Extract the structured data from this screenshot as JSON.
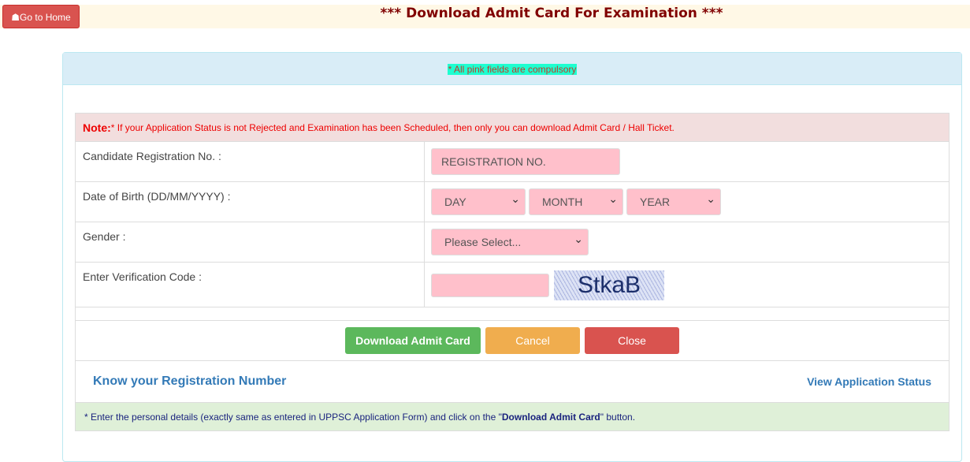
{
  "header": {
    "home_label": "Go to Home",
    "title": "*** Download Admit Card For Examination ***"
  },
  "panel": {
    "notice": "* All pink fields are compulsory"
  },
  "note": {
    "label": "Note:",
    "text": " * If your Application Status is not Rejected and Examination has been Scheduled, then only you can download Admit Card / Hall Ticket."
  },
  "form": {
    "registration": {
      "label": "Candidate Registration No. :",
      "placeholder": "REGISTRATION NO."
    },
    "dob": {
      "label": "Date of Birth (DD/MM/YYYY) :",
      "day": "DAY",
      "month": "MONTH",
      "year": "YEAR"
    },
    "gender": {
      "label": "Gender :",
      "selected": "Please Select..."
    },
    "verification": {
      "label": "Enter Verification Code :",
      "value": "",
      "captcha": "StkaB"
    }
  },
  "buttons": {
    "download": "Download Admit Card",
    "cancel": "Cancel",
    "close": "Close"
  },
  "links": {
    "know_reg": "Know your Registration Number",
    "view_status": "View Application Status"
  },
  "footer": {
    "pre": "* Enter the personal details (exactly same as entered in UPPSC Application Form) and click on the \"",
    "bold": "Download Admit Card",
    "post": " \" button."
  },
  "colors": {
    "pink": "#ffc0cb",
    "success": "#5cb85c",
    "warning": "#f0ad4e",
    "danger": "#d9534f",
    "link": "#337ab7"
  }
}
